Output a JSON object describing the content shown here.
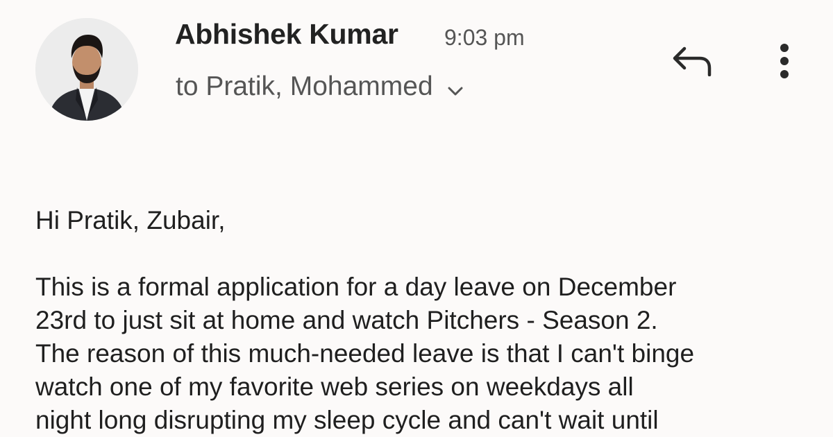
{
  "email": {
    "sender_name": "Abhishek Kumar",
    "time": "9:03 pm",
    "recipients": "to Pratik, Mohammed",
    "greeting": "Hi Pratik, Zubair,",
    "body_lines": [
      "This is a formal application for a day leave on December",
      "23rd to just sit at home and watch Pitchers - Season 2.",
      "The reason of this much-needed leave is that I can't binge",
      "watch one of my favorite web series on weekdays all",
      "night long disrupting my sleep cycle and can't wait until"
    ]
  },
  "icons": {
    "reply": "reply-icon",
    "more": "more-vert-icon",
    "expand": "chevron-down-icon",
    "avatar": "sender-avatar"
  },
  "colors": {
    "background": "#fcfaf9",
    "name": "#222222",
    "secondary": "#555555",
    "body": "#1f1f1f"
  }
}
